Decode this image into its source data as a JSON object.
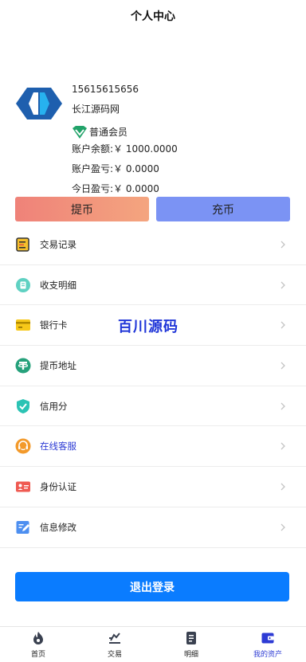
{
  "header": {
    "title": "个人中心"
  },
  "profile": {
    "phone": "15615615656",
    "name": "长江源码网",
    "level": "普通会员",
    "balance": "账户余额:￥ 1000.0000",
    "profit": "账户盈亏:￥ 0.0000",
    "today_profit": "今日盈亏:￥ 0.0000"
  },
  "actions": {
    "withdraw": "提币",
    "deposit": "充币"
  },
  "menu": [
    {
      "label": "交易记录",
      "icon": "receipt-icon"
    },
    {
      "label": "收支明细",
      "icon": "ledger-icon"
    },
    {
      "label": "银行卡",
      "icon": "card-icon"
    },
    {
      "label": "提币地址",
      "icon": "tether-icon"
    },
    {
      "label": "信用分",
      "icon": "shield-check-icon"
    },
    {
      "label": "在线客服",
      "icon": "headset-icon"
    },
    {
      "label": "身份认证",
      "icon": "id-card-icon"
    },
    {
      "label": "信息修改",
      "icon": "edit-icon"
    }
  ],
  "watermark": "百川源码",
  "logout": "退出登录",
  "tabs": [
    {
      "label": "首页",
      "icon": "home-icon"
    },
    {
      "label": "交易",
      "icon": "trade-icon"
    },
    {
      "label": "明细",
      "icon": "detail-icon"
    },
    {
      "label": "我的资产",
      "icon": "wallet-icon"
    }
  ],
  "colors": {
    "accent": "#0a7cff",
    "withdraw": "#ef8279",
    "deposit": "#7b93f4",
    "active_tab": "#2d3bd4"
  }
}
